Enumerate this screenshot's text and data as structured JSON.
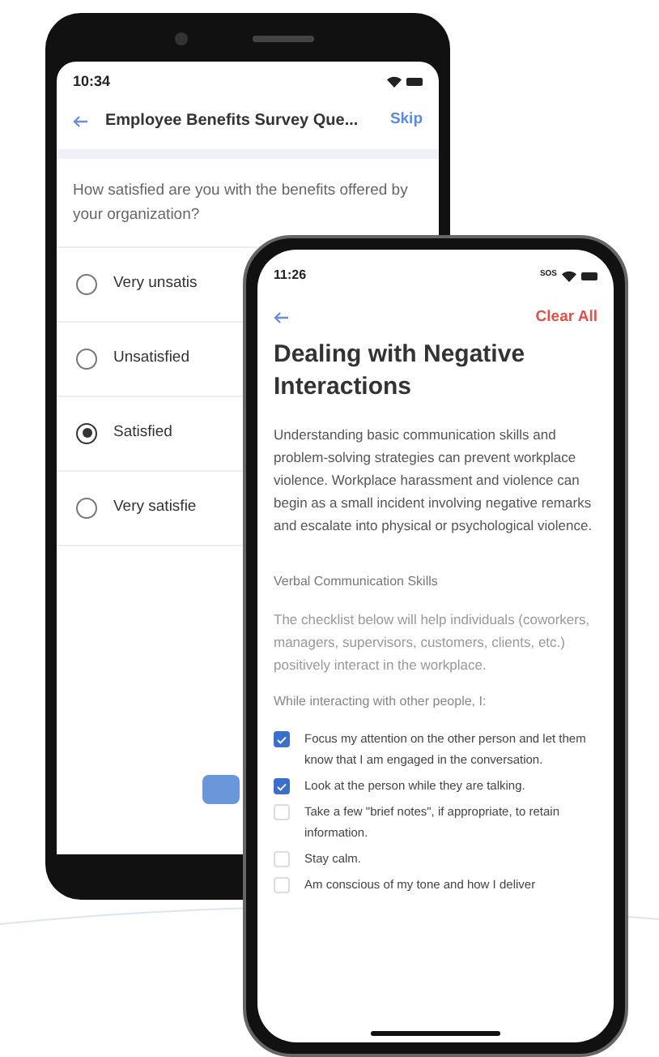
{
  "survey_phone": {
    "status_time": "10:34",
    "title": "Employee Benefits Survey Que...",
    "skip": "Skip",
    "question": "How satisfied are you with the benefits offered by your organization?",
    "options": [
      {
        "label": "Very unsatis",
        "selected": false
      },
      {
        "label": "Unsatisfied",
        "selected": false
      },
      {
        "label": "Satisfied",
        "selected": true
      },
      {
        "label": "Very satisfie",
        "selected": false
      }
    ]
  },
  "lesson_phone": {
    "status_time": "11:26",
    "status_network": "SOS",
    "clear_all": "Clear All",
    "title": "Dealing with Negative Interactions",
    "intro": "Understanding basic communication skills and problem-solving strategies can prevent workplace violence. Workplace harassment and violence can begin as a small incident involving negative remarks and escalate into physical or psychological violence.",
    "section": "Verbal Communication Skills",
    "description": "The checklist below will help individuals (coworkers, managers, supervisors, customers, clients, etc.) positively interact in the workplace.",
    "prompt": "While interacting with other people, I:",
    "checklist": [
      {
        "label": "Focus my attention on the other person and let them know that I am engaged in the conversation.",
        "checked": true
      },
      {
        "label": "Look at the person while they are talking.",
        "checked": true
      },
      {
        "label": "Take a few \"brief notes\", if appropriate, to retain information.",
        "checked": false
      },
      {
        "label": "Stay calm.",
        "checked": false
      },
      {
        "label": "Am conscious of my tone and how I deliver",
        "checked": false
      }
    ]
  }
}
